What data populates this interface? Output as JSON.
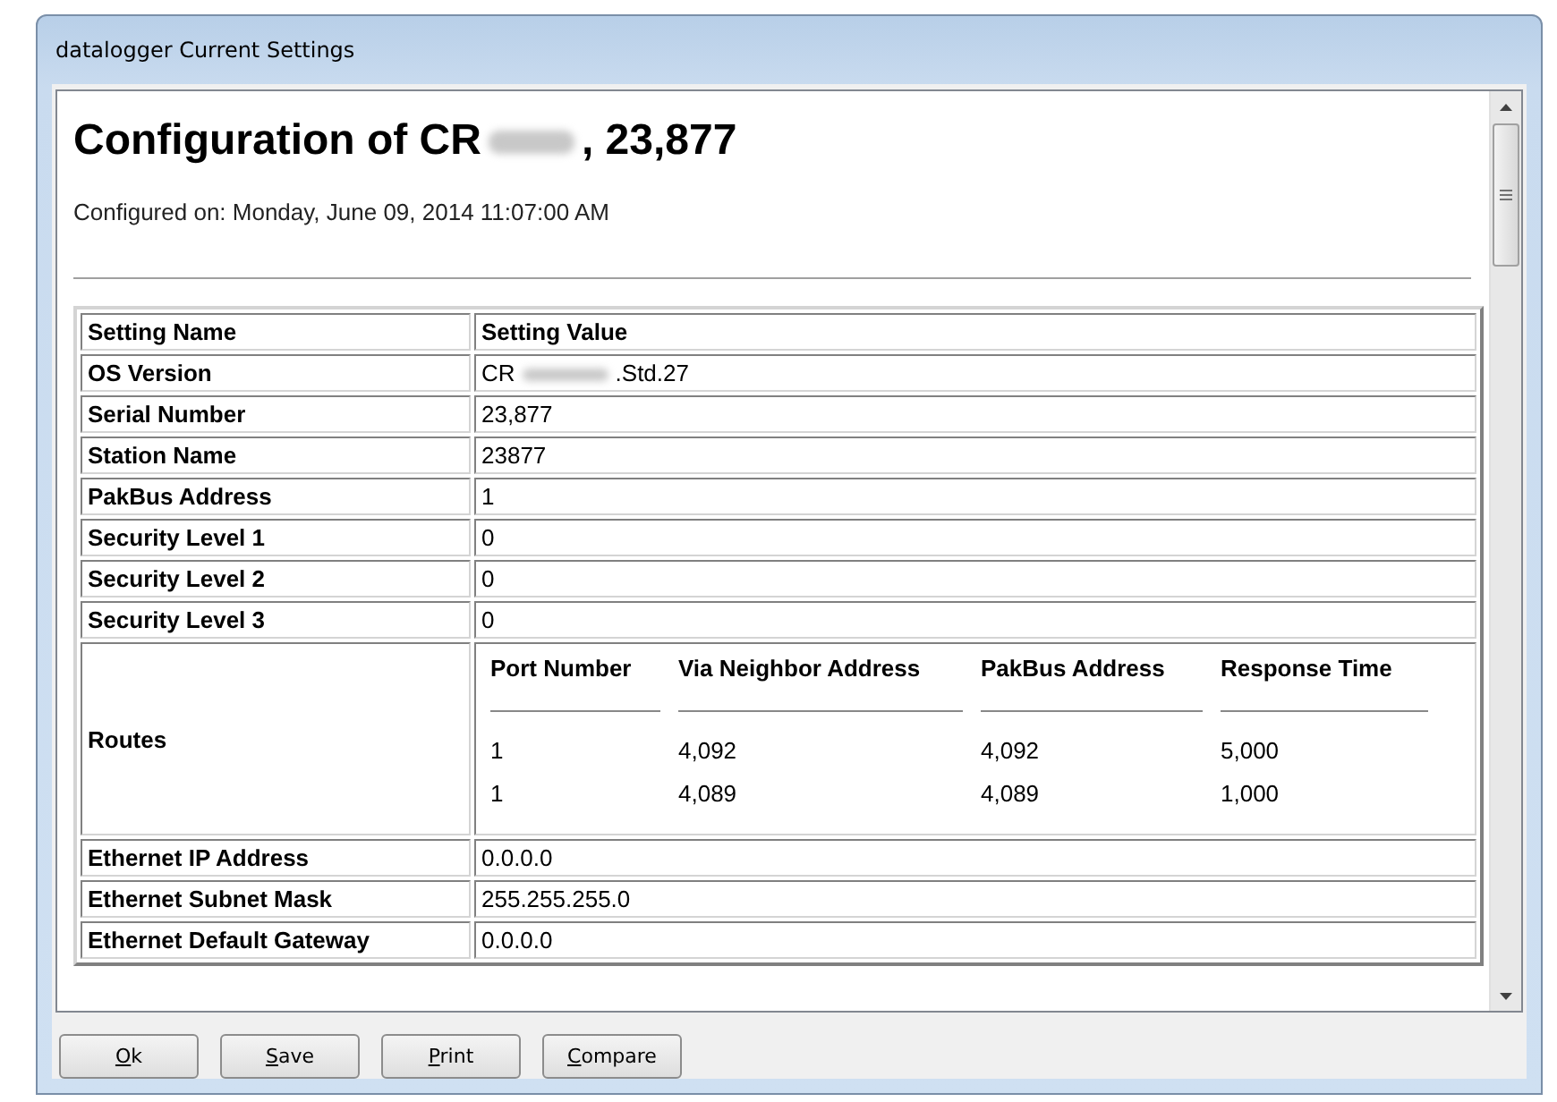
{
  "window": {
    "title": "datalogger Current Settings"
  },
  "report": {
    "title": {
      "before": "Configuration of CR",
      "after": ", 23,877"
    },
    "configured": "Configured on: Monday, June 09, 2014 11:07:00 AM",
    "columns": [
      "Setting Name",
      "Setting Value"
    ],
    "rows": [
      {
        "kind": "redacted",
        "name": "OS Version",
        "value": {
          "before": "CR",
          "after": ".Std.27"
        }
      },
      {
        "kind": "text",
        "name": "Serial Number",
        "value": "23,877"
      },
      {
        "kind": "text",
        "name": "Station Name",
        "value": "23877"
      },
      {
        "kind": "text",
        "name": "PakBus Address",
        "value": "1"
      },
      {
        "kind": "text",
        "name": "Security Level 1",
        "value": "0"
      },
      {
        "kind": "text",
        "name": "Security Level 2",
        "value": "0"
      },
      {
        "kind": "text",
        "name": "Security Level 3",
        "value": "0"
      },
      {
        "kind": "routes",
        "name": "Routes",
        "columns": [
          "Port Number",
          "Via Neighbor Address",
          "PakBus Address",
          "Response Time"
        ],
        "routes": [
          [
            "1",
            "4,092",
            "4,092",
            "5,000"
          ],
          [
            "1",
            "4,089",
            "4,089",
            "1,000"
          ]
        ]
      },
      {
        "kind": "text",
        "name": "Ethernet IP Address",
        "value": "0.0.0.0"
      },
      {
        "kind": "text",
        "name": "Ethernet Subnet Mask",
        "value": "255.255.255.0"
      },
      {
        "kind": "text",
        "name": "Ethernet Default Gateway",
        "value": "0.0.0.0"
      }
    ]
  },
  "buttons": [
    {
      "label": "Ok"
    },
    {
      "label": "Save"
    },
    {
      "label": "Print"
    },
    {
      "label": "Compare"
    }
  ]
}
